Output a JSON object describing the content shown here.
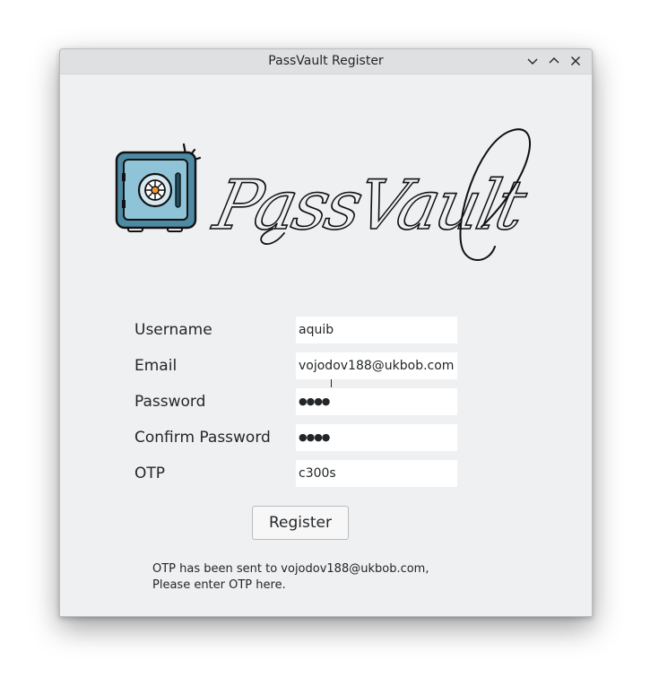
{
  "window": {
    "title": "PassVault Register"
  },
  "logo": {
    "text": "PassVault"
  },
  "form": {
    "username_label": "Username",
    "username_value": "aquib",
    "email_label": "Email",
    "email_value": "vojodov188@ukbob.com",
    "password_label": "Password",
    "password_value": "●●●●",
    "confirm_password_label": "Confirm Password",
    "confirm_password_value": "●●●●",
    "otp_label": "OTP",
    "otp_value": "c300s"
  },
  "register_button": {
    "label": "Register"
  },
  "message": {
    "line1": "OTP has been sent to vojodov188@ukbob.com,",
    "line2": "Please enter OTP here."
  },
  "icons": {
    "minimize": "chevron-down-icon",
    "maximize": "chevron-up-icon",
    "close": "close-icon",
    "logo": "safe-icon"
  }
}
